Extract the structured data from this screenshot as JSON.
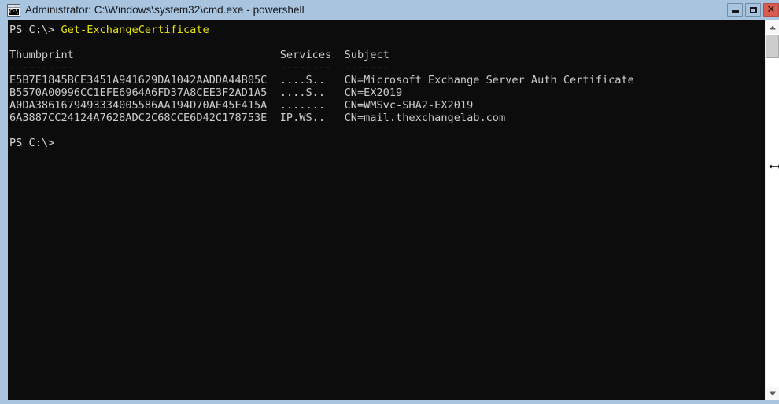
{
  "window": {
    "title": "Administrator: C:\\Windows\\system32\\cmd.exe - powershell",
    "icon_label": "C:\\",
    "controls": {
      "minimize": "–",
      "maximize": "□",
      "close": "✕"
    },
    "colors": {
      "titlebar": "#a9c4de",
      "console_bg": "#0c0c0c",
      "close_button": "#d95c51",
      "prompt_text": "#d6d6d6",
      "command_text": "#e5e510"
    }
  },
  "console": {
    "prompt": "PS C:\\> ",
    "command": "Get-ExchangeCertificate",
    "blank_after_command": "",
    "table": {
      "headers": [
        "Thumbprint",
        "Services",
        "Subject"
      ],
      "separators": [
        "----------",
        "--------",
        "-------"
      ],
      "rows": [
        {
          "thumbprint": "E5B7E1845BCE3451A941629DA1042AADDA44B05C",
          "services": "....S..",
          "subject": "CN=Microsoft Exchange Server Auth Certificate"
        },
        {
          "thumbprint": "B5570A00996CC1EFE6964A6FD37A8CEE3F2AD1A5",
          "services": "....S..",
          "subject": "CN=EX2019"
        },
        {
          "thumbprint": "A0DA3861679493334005586AA194D70AE45E415A",
          "services": ".......",
          "subject": "CN=WMSvc-SHA2-EX2019"
        },
        {
          "thumbprint": "6A3887CC24124A7628ADC2C68CCE6D42C178753E",
          "services": "IP.WS..",
          "subject": "CN=mail.thexchangelab.com"
        }
      ]
    },
    "trailing_prompt": "PS C:\\>",
    "header_line": "Thumbprint                                Services  Subject",
    "separator_line": "----------                                --------  -------",
    "body_lines": [
      "E5B7E1845BCE3451A941629DA1042AADDA44B05C  ....S..   CN=Microsoft Exchange Server Auth Certificate",
      "B5570A00996CC1EFE6964A6FD37A8CEE3F2AD1A5  ....S..   CN=EX2019",
      "A0DA3861679493334005586AA194D70AE45E415A  .......   CN=WMSvc-SHA2-EX2019",
      "6A3887CC24124A7628ADC2C68CCE6D42C178753E  IP.WS..   CN=mail.thexchangelab.com"
    ]
  },
  "scrollbar": {
    "up_arrow": "▲",
    "down_arrow": "▼"
  }
}
